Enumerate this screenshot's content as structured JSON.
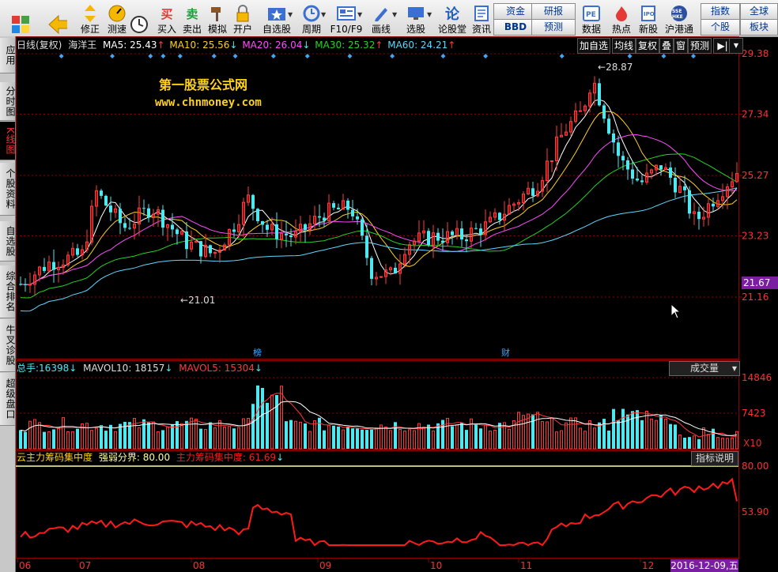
{
  "toolbar": {
    "items": [
      {
        "label": "",
        "icon": "windows-icon"
      },
      {
        "label": "",
        "icon": "back-arrow-icon"
      },
      {
        "label": "修正",
        "icon": "up-down-icon"
      },
      {
        "label": "测速",
        "icon": "speedometer-icon"
      },
      {
        "label": "",
        "icon": "clock-icon"
      },
      {
        "label": "买入",
        "icon": "buy-icon",
        "glyph": "买"
      },
      {
        "label": "卖出",
        "icon": "sell-icon",
        "glyph": "卖"
      },
      {
        "label": "模拟",
        "icon": "hammer-icon"
      },
      {
        "label": "开户",
        "icon": "lock-icon"
      },
      {
        "label": "自选股",
        "icon": "star-folder-icon"
      },
      {
        "label": "周期",
        "icon": "cycle-icon"
      },
      {
        "label": "F10/F9",
        "icon": "f10-icon"
      },
      {
        "label": "画线",
        "icon": "pen-icon"
      },
      {
        "label": "选股",
        "icon": "monitor-icon"
      },
      {
        "label": "论股堂",
        "icon": "discuss-icon",
        "glyph": "论"
      },
      {
        "label": "资讯",
        "icon": "news-icon"
      },
      {
        "label": "数据",
        "icon": "pe-icon"
      },
      {
        "label": "热点",
        "icon": "hot-icon"
      },
      {
        "label": "新股",
        "icon": "ipo-icon"
      },
      {
        "label": "沪港通",
        "icon": "sse-hke-icon"
      }
    ],
    "small_buttons": [
      "资金",
      "研报",
      "BBD",
      "预测",
      "指数",
      "全球",
      "个股",
      "板块"
    ]
  },
  "sidebar": {
    "tabs": [
      "应用",
      "分时图",
      "K线图",
      "个股资料",
      "自选股",
      "综合排名",
      "牛叉诊股",
      "超级盘口"
    ],
    "active_index": 2
  },
  "kline": {
    "title": "日线(复权)",
    "stock": "海洋王",
    "ma": [
      {
        "name": "MA5",
        "value": "25.43",
        "arrow": "↑",
        "color": "#ffffff"
      },
      {
        "name": "MA10",
        "value": "25.56",
        "arrow": "↓",
        "color": "#ffd21a"
      },
      {
        "name": "MA20",
        "value": "26.04",
        "arrow": "↓",
        "color": "#ff4cff"
      },
      {
        "name": "MA30",
        "value": "25.32",
        "arrow": "↑",
        "color": "#28d228"
      },
      {
        "name": "MA60",
        "value": "24.21",
        "arrow": "↑",
        "color": "#5fd8ff"
      }
    ],
    "chips": [
      "加自选",
      "均线",
      "复权",
      "叠",
      "窗",
      "预测"
    ],
    "high_label": "28.87",
    "low_label": "21.01",
    "current_price": "21.67",
    "y_ticks": [
      "29.38",
      "27.34",
      "25.27",
      "23.23",
      "21.16"
    ],
    "markers": [
      "榜",
      "财"
    ],
    "watermark_title": "第一股票公式网",
    "watermark_url": "www.chnmoney.com"
  },
  "volume": {
    "total_label": "总手:",
    "total_value": "16398",
    "total_arrow": "↓",
    "mavol10_label": "MAVOL10:",
    "mavol10_value": "18157",
    "mavol10_arrow": "↓",
    "mavol5_label": "MAVOL5:",
    "mavol5_value": "15304",
    "mavol5_arrow": "↓",
    "dropdown": "成交量",
    "y_ticks": [
      "14846",
      "7423"
    ],
    "unit": "X10"
  },
  "indicator": {
    "name": "云主力筹码集中度",
    "threshold_label": "强弱分界:",
    "threshold_value": "80.00",
    "line_label": "主力筹码集中度:",
    "line_value": "61.69",
    "line_arrow": "↓",
    "help_button": "指标说明",
    "y_ticks": [
      "80.00",
      "53.90"
    ]
  },
  "x_axis": {
    "months": [
      "06",
      "07",
      "08",
      "09",
      "10",
      "11",
      "12"
    ],
    "current_date": "2016-12-09,五"
  },
  "colors": {
    "up": "#ff3b3b",
    "down": "#4de8f0",
    "grid": "#8b0000",
    "axis_text": "#ff3030",
    "ma5": "#ffffff",
    "ma10": "#ffd21a",
    "ma20": "#ff4cff",
    "ma30": "#28d228",
    "ma60": "#5fd8ff",
    "indicator_line": "#ff1a1a",
    "threshold_line": "#ffffa0",
    "marker": "#3aa8ff"
  }
}
